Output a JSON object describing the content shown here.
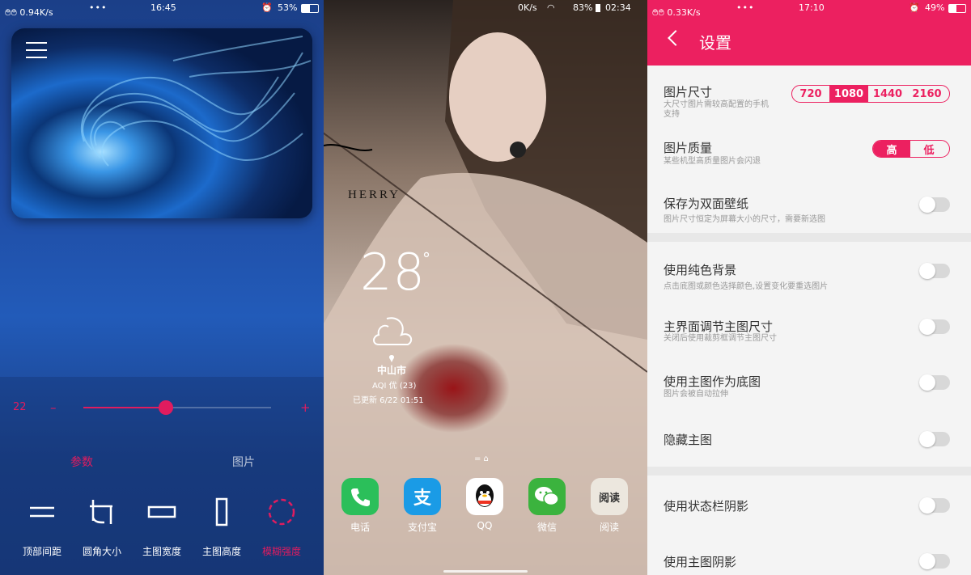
{
  "panel1": {
    "status": {
      "signal": "࿉࿉ 0.94K/s",
      "dots": "•••",
      "time": "16:45",
      "battery": "53%"
    },
    "slider": {
      "value": 22,
      "min_sign": "–",
      "max_sign": "+",
      "fraction": 0.44
    },
    "tabs": [
      {
        "label": "参数",
        "active": true
      },
      {
        "label": "图片",
        "active": false
      }
    ],
    "tools": [
      {
        "label": "顶部间距",
        "icon": "top-spacing-icon"
      },
      {
        "label": "圆角大小",
        "icon": "corner-radius-icon"
      },
      {
        "label": "主图宽度",
        "icon": "width-icon"
      },
      {
        "label": "主图高度",
        "icon": "height-icon"
      },
      {
        "label": "模糊强度",
        "icon": "blur-icon",
        "active": true
      }
    ],
    "colors": {
      "accent": "#e01c5f"
    }
  },
  "panel2": {
    "status": {
      "speed": "0K/s",
      "battery": "83%",
      "time": "02:34"
    },
    "wallpaper_text": "HERRY",
    "weather": {
      "temp": "28",
      "deg": "°",
      "city": "中山市",
      "aqi": "AQI 优 (23)",
      "updated": "已更新 6/22 01:51"
    },
    "dock": [
      {
        "label": "电话",
        "icon": "phone-icon",
        "color": "#2bbf5a"
      },
      {
        "label": "支付宝",
        "icon": "alipay-icon",
        "color": "#1a9be6"
      },
      {
        "label": "QQ",
        "icon": "qq-icon",
        "color": "#ffffff"
      },
      {
        "label": "微信",
        "icon": "wechat-icon",
        "color": "#3bb33e"
      },
      {
        "label": "阅读",
        "icon": "reader-icon",
        "color": "#e8e4dc",
        "glyph": "阅读"
      }
    ]
  },
  "panel3": {
    "status": {
      "signal": "࿉࿉ 0.33K/s",
      "dots": "•••",
      "time": "17:10",
      "battery": "49%"
    },
    "title": "设置",
    "settings": [
      {
        "title": "图片尺寸",
        "sub": "大尺寸图片需较高配置的手机\n支持",
        "control": "segment",
        "options": [
          "720",
          "1080",
          "1440",
          "2160"
        ],
        "selected": "1080"
      },
      {
        "title": "图片质量",
        "sub": "某些机型高质量图片会闪退",
        "control": "segment",
        "options": [
          "高",
          "低"
        ],
        "selected": "高"
      },
      {
        "title": "保存为双面壁纸",
        "sub": "图片尺寸恒定为屏幕大小的尺寸，需要新选图",
        "control": "toggle",
        "on": false
      },
      {
        "title": "使用纯色背景",
        "sub": "点击底图或颜色选择颜色,设置变化要重选图片",
        "control": "toggle",
        "on": false
      },
      {
        "title": "主界面调节主图尺寸",
        "sub": "关闭后使用裁剪框调节主图尺寸",
        "control": "toggle",
        "on": false
      },
      {
        "title": "使用主图作为底图",
        "sub": "图片会被自动拉伸",
        "control": "toggle",
        "on": false
      },
      {
        "title": "隐藏主图",
        "sub": "",
        "control": "toggle",
        "on": false
      },
      {
        "title": "使用状态栏阴影",
        "sub": "",
        "control": "toggle",
        "on": false
      },
      {
        "title": "使用主图阴影",
        "sub": "",
        "control": "toggle",
        "on": false
      }
    ],
    "colors": {
      "accent": "#ec2060"
    }
  }
}
